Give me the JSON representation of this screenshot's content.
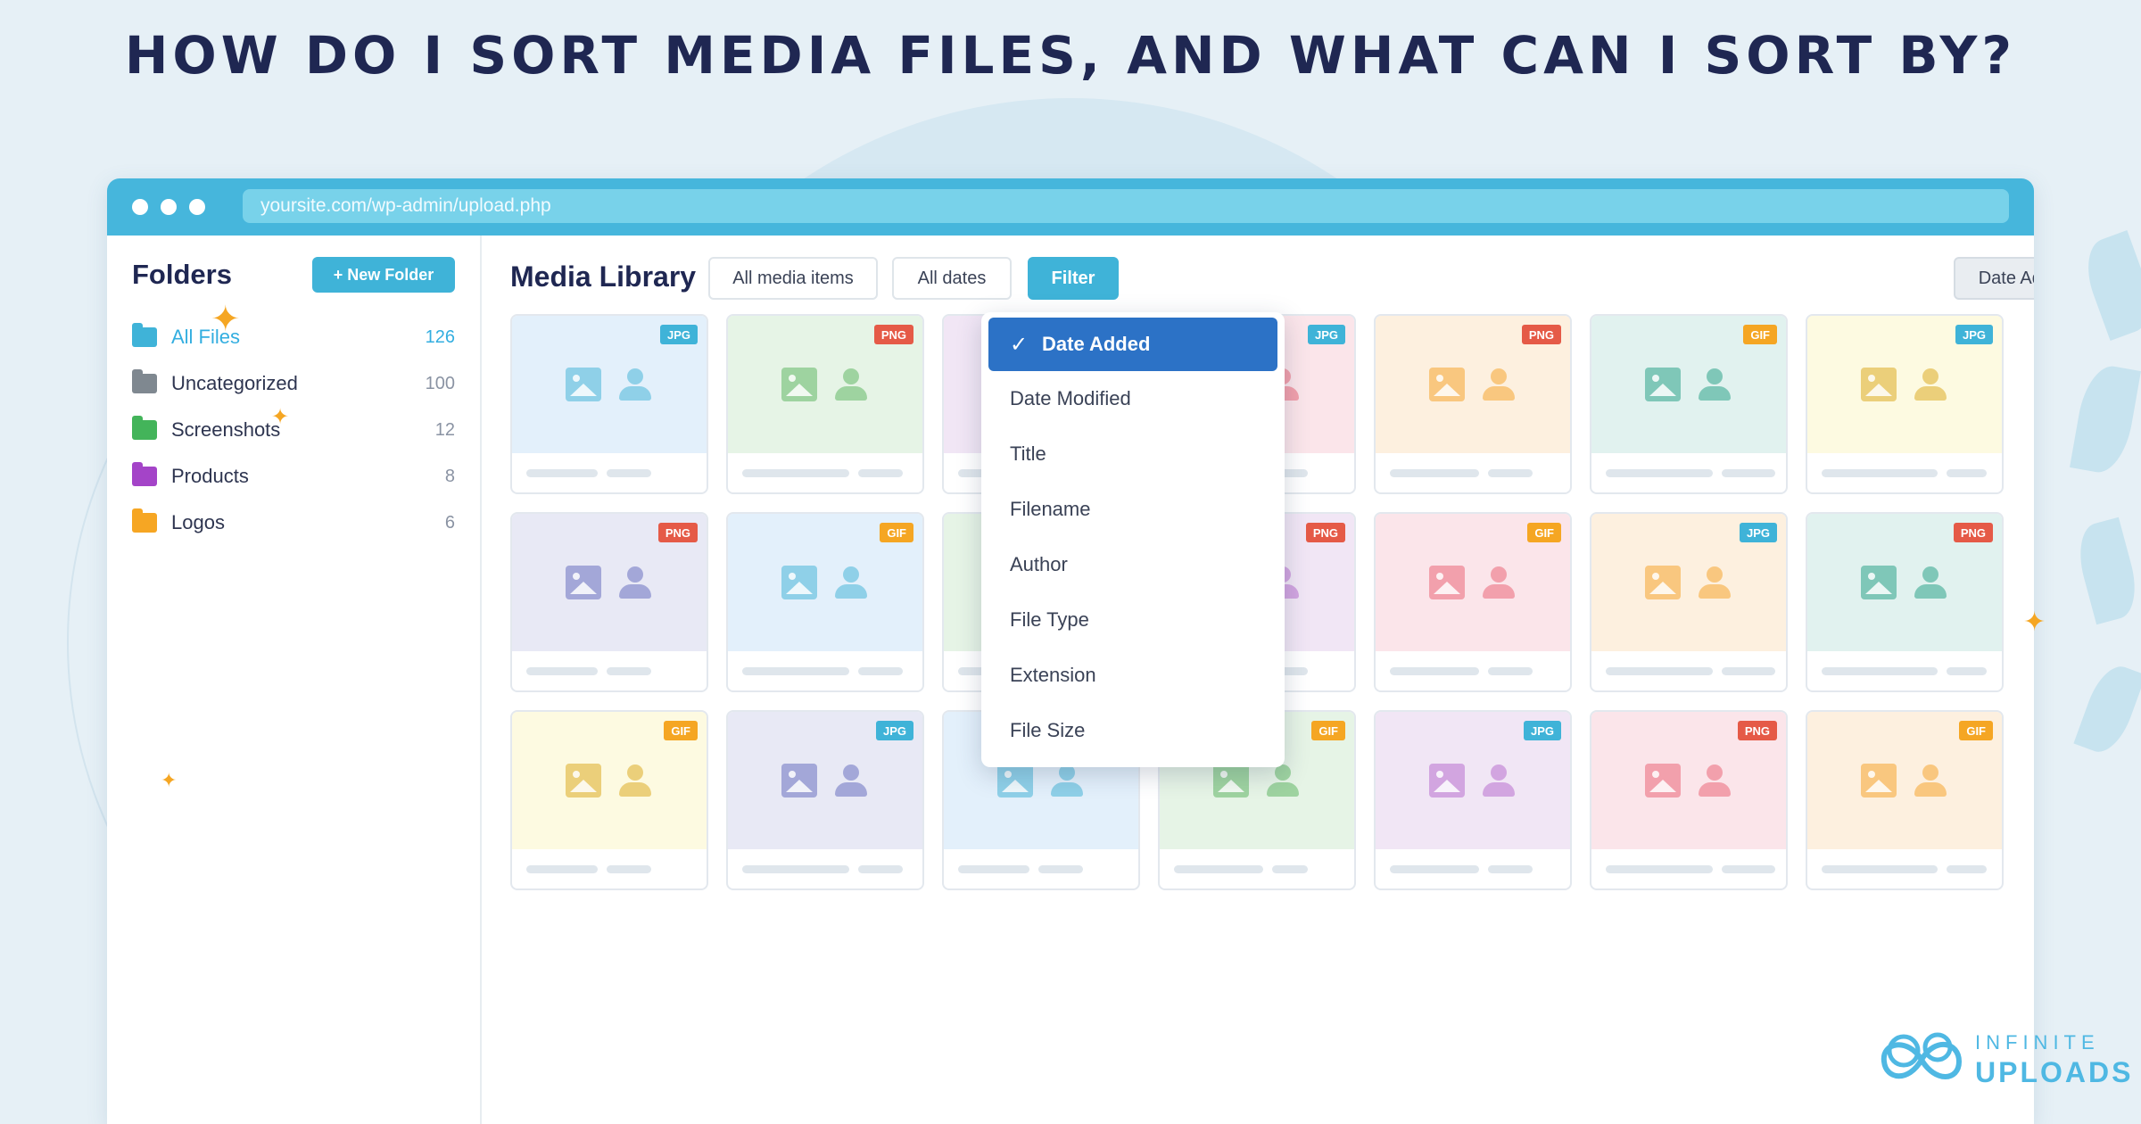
{
  "headline": "HOW DO I SORT MEDIA FILES, AND WHAT CAN I SORT BY?",
  "browser": {
    "url": "yoursite.com/wp-admin/upload.php"
  },
  "sidebar": {
    "title": "Folders",
    "new_folder_label": "+ New Folder",
    "folders": [
      {
        "label": "All Files",
        "count": "126",
        "color": "#3fb3d8",
        "active": true
      },
      {
        "label": "Uncategorized",
        "count": "100",
        "color": "#7f8890"
      },
      {
        "label": "Screenshots",
        "count": "12",
        "color": "#43b45a"
      },
      {
        "label": "Products",
        "count": "8",
        "color": "#a444c8"
      },
      {
        "label": "Logos",
        "count": "6",
        "color": "#f6a623"
      }
    ]
  },
  "main": {
    "title": "Media Library",
    "filter_all_media": "All media items",
    "filter_all_dates": "All dates",
    "filter_button": "Filter",
    "sort_button": "Date Added"
  },
  "sort_menu": {
    "items": [
      "Date Added",
      "Date Modified",
      "Title",
      "Filename",
      "Author",
      "File Type",
      "Extension",
      "File Size"
    ],
    "selected": "Date Added"
  },
  "badge_colors": {
    "JPG": "#3fb3d8",
    "PNG": "#e55a47",
    "GIF": "#f5a623"
  },
  "media_cards": [
    {
      "badge": "JPG",
      "bg": "#e3f0fb",
      "fg": "#8fd0e8"
    },
    {
      "badge": "PNG",
      "bg": "#e6f4e6",
      "fg": "#9ed3a0"
    },
    {
      "badge": "GIF",
      "bg": "#f1e6f5",
      "fg": "#d2a5e0"
    },
    {
      "badge": "JPG",
      "bg": "#fbe5ea",
      "fg": "#f2a0ac"
    },
    {
      "badge": "PNG",
      "bg": "#fdf0df",
      "fg": "#f9c77f"
    },
    {
      "badge": "GIF",
      "bg": "#e1f2ef",
      "fg": "#7fc7b8"
    },
    {
      "badge": "JPG",
      "bg": "#fdfae1",
      "fg": "#ebcf7a"
    },
    {
      "badge": "PNG",
      "bg": "#e8e9f5",
      "fg": "#a3a7d8"
    },
    {
      "badge": "GIF",
      "bg": "#e3f0fb",
      "fg": "#8fd0e8"
    },
    {
      "badge": "JPG",
      "bg": "#e6f4e6",
      "fg": "#9ed3a0"
    },
    {
      "badge": "PNG",
      "bg": "#f1e6f5",
      "fg": "#d2a5e0"
    },
    {
      "badge": "GIF",
      "bg": "#fbe5ea",
      "fg": "#f2a0ac"
    },
    {
      "badge": "JPG",
      "bg": "#fdf0df",
      "fg": "#f9c77f"
    },
    {
      "badge": "PNG",
      "bg": "#e1f2ef",
      "fg": "#7fc7b8"
    },
    {
      "badge": "GIF",
      "bg": "#fdfae1",
      "fg": "#ebcf7a"
    },
    {
      "badge": "JPG",
      "bg": "#e8e9f5",
      "fg": "#a3a7d8"
    },
    {
      "badge": "PNG",
      "bg": "#e3f0fb",
      "fg": "#8fd0e8"
    },
    {
      "badge": "GIF",
      "bg": "#e6f4e6",
      "fg": "#9ed3a0"
    },
    {
      "badge": "JPG",
      "bg": "#f1e6f5",
      "fg": "#d2a5e0"
    },
    {
      "badge": "PNG",
      "bg": "#fbe5ea",
      "fg": "#f2a0ac"
    },
    {
      "badge": "GIF",
      "bg": "#fdf0df",
      "fg": "#f9c77f"
    }
  ],
  "logo": {
    "line1": "INFINITE",
    "line2": "UPLOADS"
  }
}
